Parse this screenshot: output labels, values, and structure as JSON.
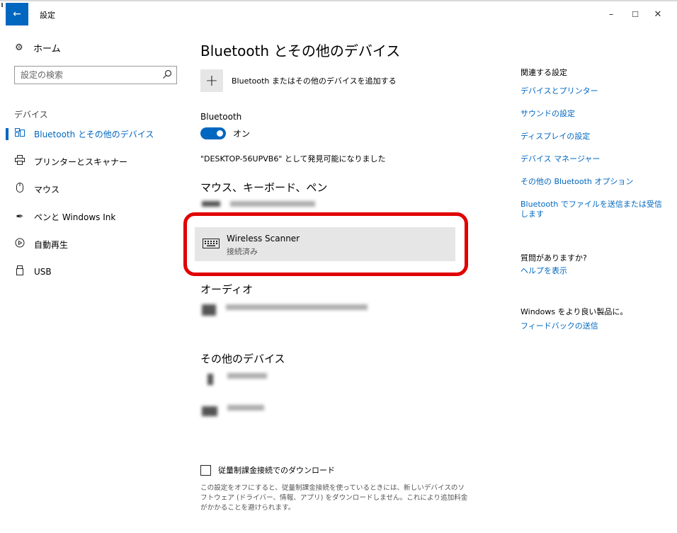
{
  "window": {
    "title": "設定",
    "controls": {
      "minimize": "–",
      "maximize": "☐",
      "close": "✕"
    }
  },
  "sidebar": {
    "home_label": "ホーム",
    "search_placeholder": "設定の検索",
    "section_label": "デバイス",
    "items": [
      {
        "label": "Bluetooth とその他のデバイス",
        "icon": "bluetooth-devices-icon",
        "active": true
      },
      {
        "label": "プリンターとスキャナー",
        "icon": "printer-icon",
        "active": false
      },
      {
        "label": "マウス",
        "icon": "mouse-icon",
        "active": false
      },
      {
        "label": "ペンと Windows Ink",
        "icon": "pen-icon",
        "active": false
      },
      {
        "label": "自動再生",
        "icon": "autoplay-icon",
        "active": false
      },
      {
        "label": "USB",
        "icon": "usb-icon",
        "active": false
      }
    ]
  },
  "main": {
    "title": "Bluetooth とその他のデバイス",
    "add_device_label": "Bluetooth またはその他のデバイスを追加する",
    "bluetooth_label": "Bluetooth",
    "bluetooth_state": "オン",
    "discoverable_text": "\"DESKTOP-56UPVB6\" として発見可能になりました",
    "sections": {
      "input": "マウス、キーボード、ペン",
      "audio": "オーディオ",
      "other": "その他のデバイス"
    },
    "selected_device": {
      "name": "Wireless Scanner",
      "status": "接続済み"
    },
    "metered": {
      "label": "従量制課金接続でのダウンロード",
      "checked": false,
      "description": "この設定をオフにすると、従量制課金接続を使っているときには、新しいデバイスのソフトウェア (ドライバー、情報、アプリ) をダウンロードしません。これにより追加料金がかかることを避けられます。"
    }
  },
  "related": {
    "heading": "関連する設定",
    "links": [
      "デバイスとプリンター",
      "サウンドの設定",
      "ディスプレイの設定",
      "デバイス マネージャー",
      "その他の Bluetooth オプション",
      "Bluetooth でファイルを送信または受信します"
    ],
    "question_heading": "質問がありますか?",
    "help_link": "ヘルプを表示",
    "feedback_heading": "Windows をより良い製品に。",
    "feedback_link": "フィードバックの送信"
  },
  "colors": {
    "accent": "#0067c0",
    "highlight": "#e00000",
    "card": "#e6e6e6"
  }
}
